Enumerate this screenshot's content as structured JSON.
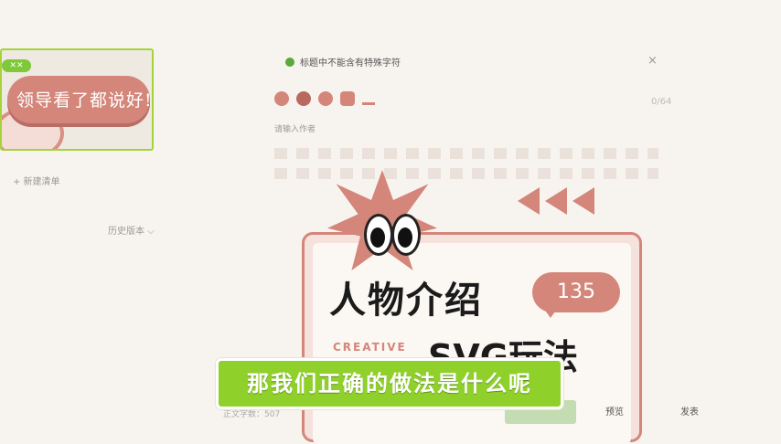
{
  "sticker": {
    "badge": "✕✕",
    "text": "领导看了都说好!"
  },
  "sidebar": {
    "new_list": "+  新建清单",
    "history": "历史版本 ⌵"
  },
  "notice": {
    "text": "标题中不能含有特殊字符",
    "close": "×"
  },
  "editor": {
    "counter": "0/64",
    "author_placeholder": "请输入作者"
  },
  "card": {
    "title": "人物介绍",
    "number": "135",
    "creative": "CREATIVE",
    "svg_title": "SVG玩法"
  },
  "footer": {
    "word_count": "正文字数：507",
    "preview": "预览",
    "publish": "发表"
  },
  "subtitle": "那我们正确的做法是什么呢",
  "colors": {
    "accent_pink": "#d4867a",
    "accent_green": "#8fd12a",
    "status_green": "#5ca83a"
  }
}
